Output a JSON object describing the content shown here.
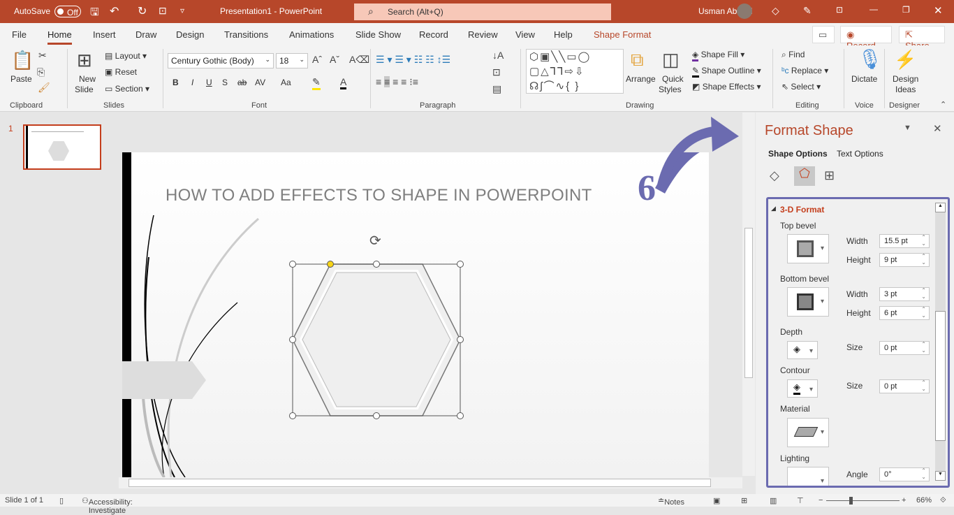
{
  "titlebar": {
    "autosave": "AutoSave",
    "autosave_state": "Off",
    "doc_title": "Presentation1  -  PowerPoint",
    "search_placeholder": "Search (Alt+Q)",
    "user": "Usman Abbasi"
  },
  "tabs": [
    "File",
    "Home",
    "Insert",
    "Draw",
    "Design",
    "Transitions",
    "Animations",
    "Slide Show",
    "Record",
    "Review",
    "View",
    "Help",
    "Shape Format"
  ],
  "active_tab": "Home",
  "tab_buttons": {
    "record": "Record",
    "share": "Share"
  },
  "ribbon": {
    "clipboard": {
      "label": "Clipboard",
      "paste": "Paste"
    },
    "slides": {
      "label": "Slides",
      "new_slide": "New",
      "new_slide2": "Slide",
      "layout": "Layout",
      "reset": "Reset",
      "section": "Section"
    },
    "font": {
      "label": "Font",
      "font_name": "Century Gothic (Body)",
      "font_size": "18",
      "bold": "B",
      "italic": "I",
      "underline": "U",
      "shadow": "S",
      "strike": "ab",
      "spacing": "AV",
      "case": "Aa"
    },
    "paragraph": {
      "label": "Paragraph"
    },
    "drawing": {
      "label": "Drawing",
      "arrange": "Arrange",
      "quick_styles": "Quick",
      "quick_styles2": "Styles",
      "shape_fill": "Shape Fill",
      "shape_outline": "Shape Outline",
      "shape_effects": "Shape Effects"
    },
    "editing": {
      "label": "Editing",
      "find": "Find",
      "replace": "Replace",
      "select": "Select"
    },
    "voice": {
      "label": "Voice",
      "dictate": "Dictate"
    },
    "designer": {
      "label": "Designer",
      "design_ideas": "Design",
      "design_ideas2": "Ideas"
    }
  },
  "thumbnail": {
    "number": "1"
  },
  "slide": {
    "title": "HOW TO ADD EFFECTS TO SHAPE IN POWERPOINT",
    "annotation": "6"
  },
  "pane": {
    "title": "Format Shape",
    "tabs": [
      "Shape Options",
      "Text Options"
    ],
    "section": "3-D Format",
    "top_bevel": {
      "label": "Top bevel",
      "width_label": "Width",
      "width": "15.5 pt",
      "height_label": "Height",
      "height": "9 pt"
    },
    "bottom_bevel": {
      "label": "Bottom bevel",
      "width_label": "Width",
      "width": "3 pt",
      "height_label": "Height",
      "height": "6 pt"
    },
    "depth": {
      "label": "Depth",
      "size_label": "Size",
      "size": "0 pt"
    },
    "contour": {
      "label": "Contour",
      "size_label": "Size",
      "size": "0 pt"
    },
    "material": {
      "label": "Material"
    },
    "lighting": {
      "label": "Lighting",
      "angle_label": "Angle",
      "angle": "0°"
    }
  },
  "status": {
    "slide": "Slide 1 of 1",
    "accessibility": "Accessibility: Investigate",
    "notes": "Notes",
    "zoom": "66%"
  },
  "colors": {
    "brand": "#b7472a",
    "accent_arrow": "#6b6bb0",
    "selection": "#c43e1c"
  }
}
